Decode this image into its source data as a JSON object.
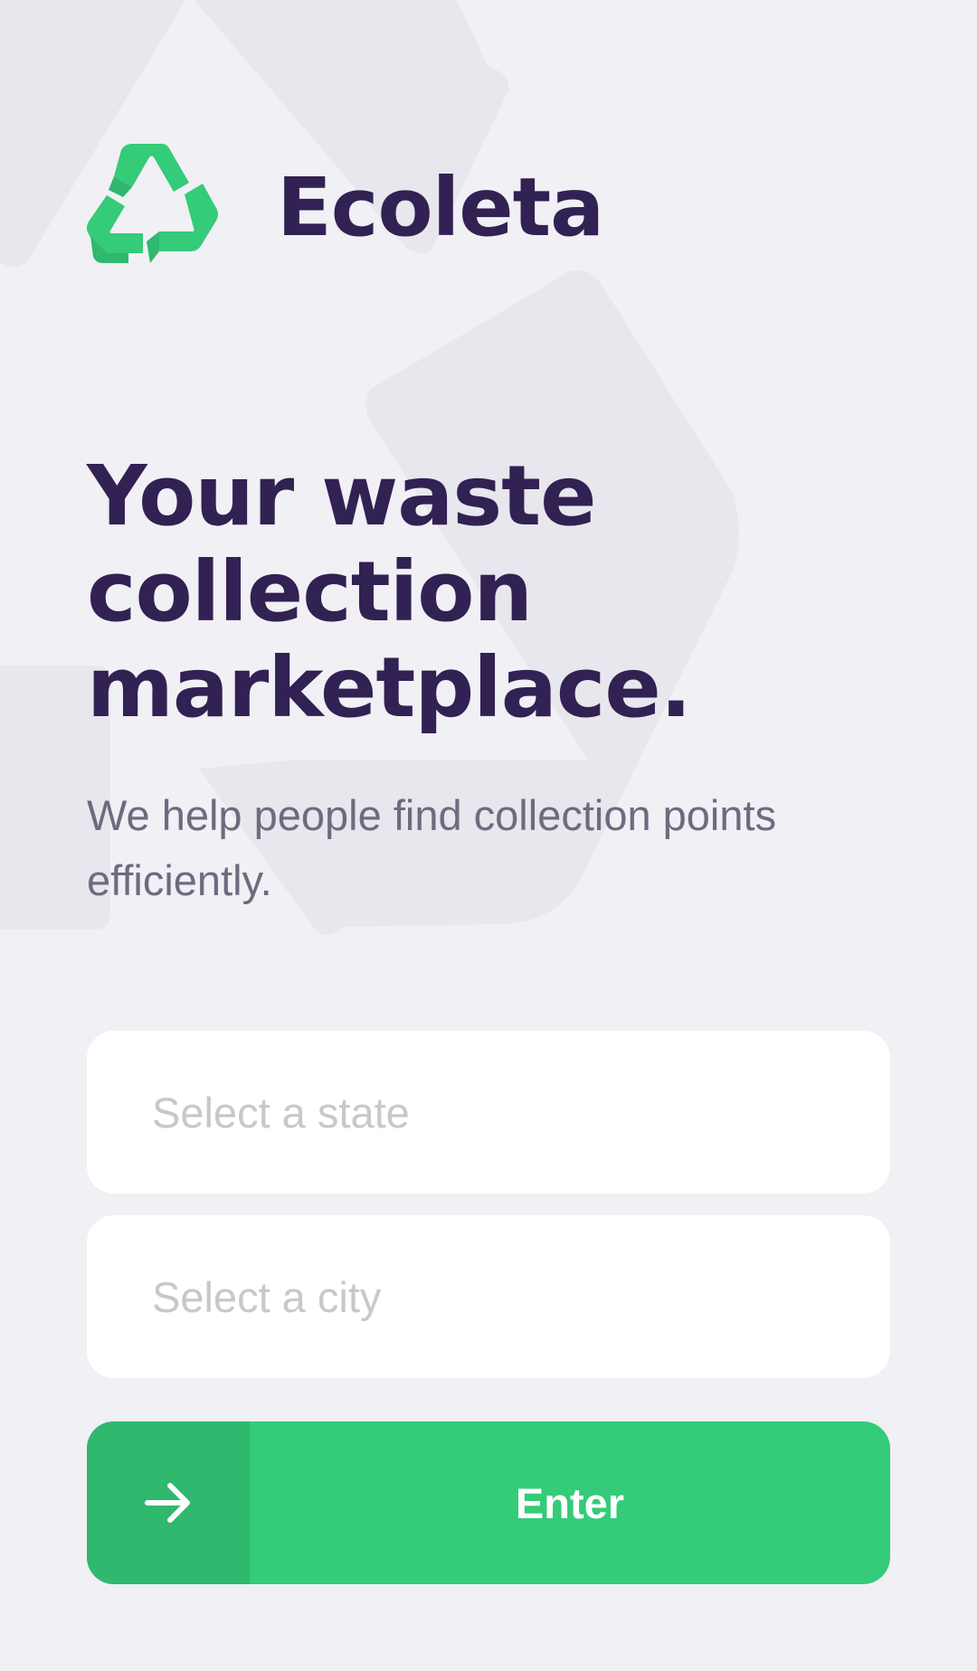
{
  "app": {
    "logo_icon": "recycle-icon",
    "name": "Ecoleta"
  },
  "hero": {
    "title": "Your waste collection marketplace.",
    "subtitle": "We help people find collection points efficiently."
  },
  "form": {
    "state_placeholder": "Select a state",
    "city_placeholder": "Select a city",
    "submit_label": "Enter",
    "submit_icon": "arrow-right-icon"
  },
  "colors": {
    "background": "#f0f0f5",
    "title": "#322153",
    "text": "#6c6c80",
    "placeholder": "#c8c8cc",
    "primary": "#34cb79",
    "primary_dark": "#2fb86e"
  }
}
